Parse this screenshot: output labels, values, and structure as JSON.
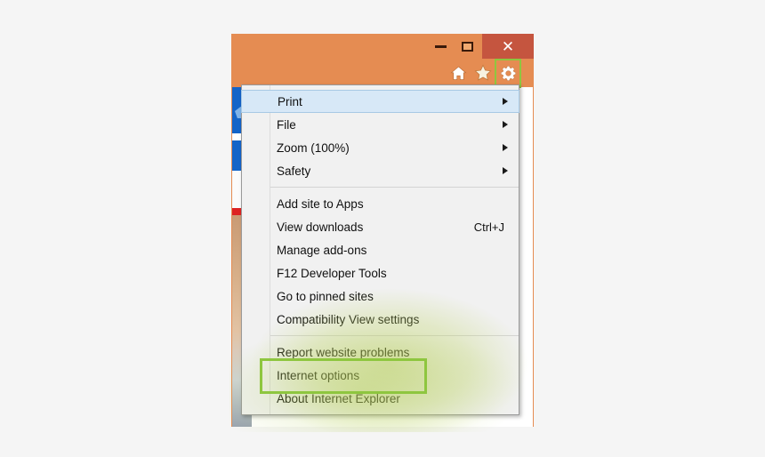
{
  "window": {
    "title_bar": {
      "buttons": [
        {
          "name": "minimize",
          "label": "–"
        },
        {
          "name": "maximize",
          "label": "□"
        },
        {
          "name": "close",
          "label": "✕"
        }
      ]
    },
    "command_bar": {
      "icons": [
        {
          "name": "home-icon",
          "label": "Home"
        },
        {
          "name": "favorites-icon",
          "label": "Favorites"
        },
        {
          "name": "settings-gear-icon",
          "label": "Tools"
        }
      ]
    },
    "frame_color": "#e58c52",
    "close_button_color": "#c5553f"
  },
  "highlights": {
    "accent_color": "#8ec63f",
    "gear_box_label": "settings-gear-highlight",
    "internet_options_box_label": "internet-options-highlight"
  },
  "menu": {
    "groups": [
      {
        "items": [
          {
            "label": "Print",
            "shortcut": "",
            "submenu": true,
            "highlighted": true
          },
          {
            "label": "File",
            "shortcut": "",
            "submenu": true,
            "highlighted": false
          },
          {
            "label": "Zoom (100%)",
            "shortcut": "",
            "submenu": true,
            "highlighted": false
          },
          {
            "label": "Safety",
            "shortcut": "",
            "submenu": true,
            "highlighted": false
          }
        ]
      },
      {
        "items": [
          {
            "label": "Add site to Apps",
            "shortcut": "",
            "submenu": false,
            "highlighted": false
          },
          {
            "label": "View downloads",
            "shortcut": "Ctrl+J",
            "submenu": false,
            "highlighted": false
          },
          {
            "label": "Manage add-ons",
            "shortcut": "",
            "submenu": false,
            "highlighted": false
          },
          {
            "label": "F12 Developer Tools",
            "shortcut": "",
            "submenu": false,
            "highlighted": false
          },
          {
            "label": "Go to pinned sites",
            "shortcut": "",
            "submenu": false,
            "highlighted": false
          },
          {
            "label": "Compatibility View settings",
            "shortcut": "",
            "submenu": false,
            "highlighted": false
          }
        ]
      },
      {
        "items": [
          {
            "label": "Report website problems",
            "shortcut": "",
            "submenu": false,
            "highlighted": false
          },
          {
            "label": "Internet options",
            "shortcut": "",
            "submenu": false,
            "highlighted": false
          },
          {
            "label": "About Internet Explorer",
            "shortcut": "",
            "submenu": false,
            "highlighted": false
          }
        ]
      }
    ]
  }
}
